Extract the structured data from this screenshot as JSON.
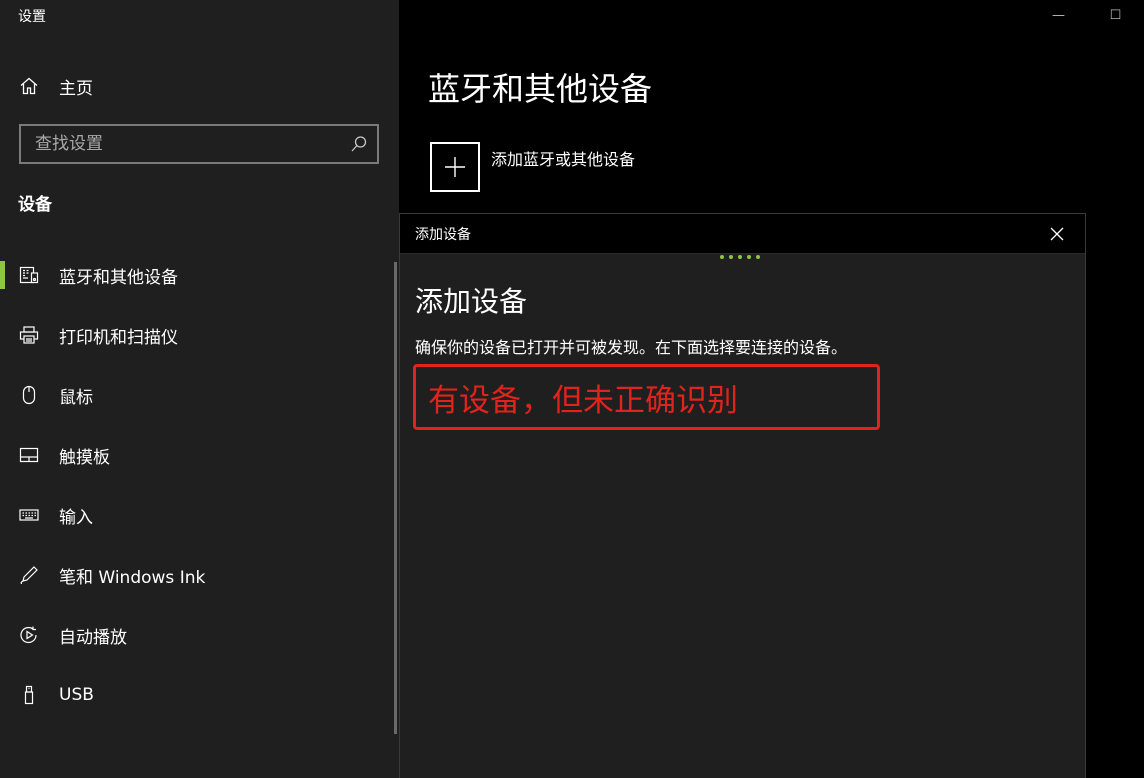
{
  "app": {
    "title": "设置"
  },
  "window_controls": {
    "minimize": "—",
    "maximize": "☐"
  },
  "sidebar": {
    "home_label": "主页",
    "search_placeholder": "查找设置",
    "section_title": "设备",
    "items": [
      {
        "label": "蓝牙和其他设备",
        "icon": "bluetooth-devices-icon",
        "active": true
      },
      {
        "label": "打印机和扫描仪",
        "icon": "printer-icon",
        "active": false
      },
      {
        "label": "鼠标",
        "icon": "mouse-icon",
        "active": false
      },
      {
        "label": "触摸板",
        "icon": "touchpad-icon",
        "active": false
      },
      {
        "label": "输入",
        "icon": "keyboard-icon",
        "active": false
      },
      {
        "label": "笔和 Windows Ink",
        "icon": "pen-icon",
        "active": false
      },
      {
        "label": "自动播放",
        "icon": "autoplay-icon",
        "active": false
      },
      {
        "label": "USB",
        "icon": "usb-icon",
        "active": false
      }
    ]
  },
  "main": {
    "title": "蓝牙和其他设备",
    "add_device_label": "添加蓝牙或其他设备"
  },
  "dialog": {
    "header_title": "添加设备",
    "title": "添加设备",
    "description": "确保你的设备已打开并可被发现。在下面选择要连接的设备。",
    "annotation": "有设备，但未正确识别"
  },
  "colors": {
    "accent": "#8ec63f",
    "annotation": "#e0231c",
    "sidebar_bg": "#1f1f1f",
    "main_bg": "#000000"
  }
}
